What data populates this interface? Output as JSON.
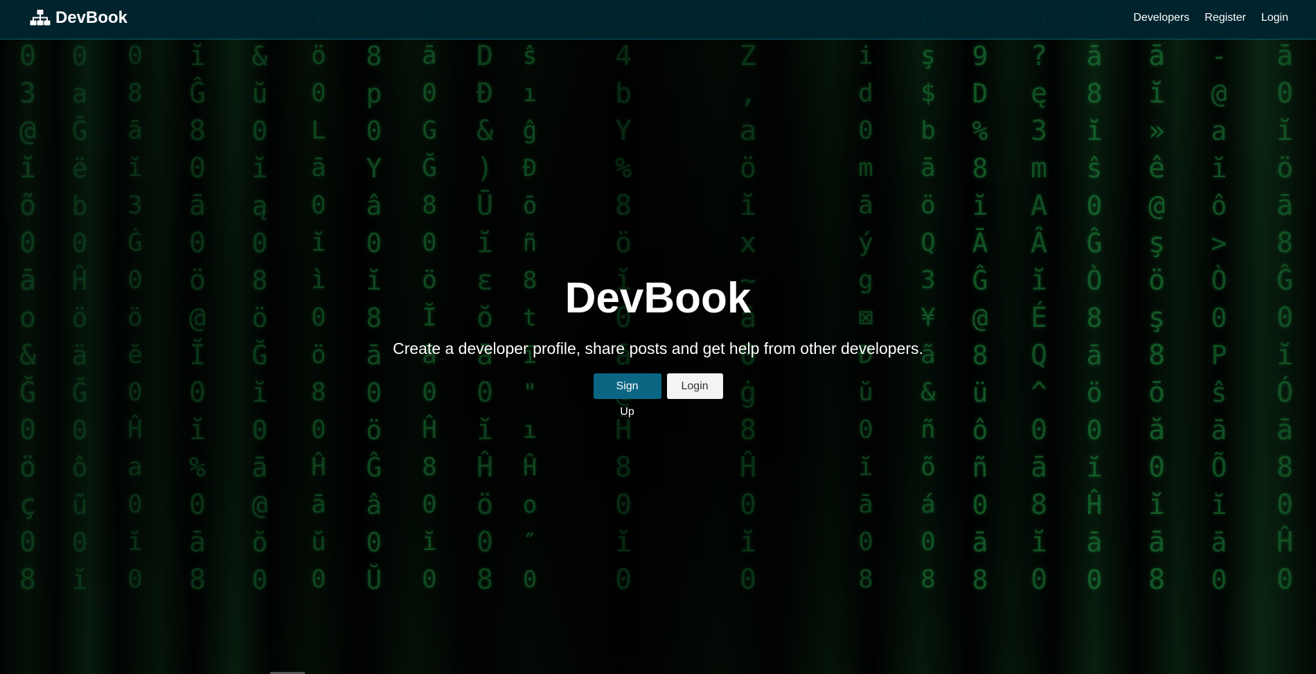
{
  "navbar": {
    "brand_icon": "sitemap-icon",
    "brand": "DevBook",
    "links": [
      "Developers",
      "Register",
      "Login"
    ]
  },
  "hero": {
    "title": "DevBook",
    "lead": "Create a developer profile, share posts and get help from other developers.",
    "signup_label": "Sign Up",
    "login_label": "Login"
  },
  "colors": {
    "navbar_bg": "#002430",
    "primary": "#0b6684",
    "light": "#f4f4f4",
    "matrix_green": "#1d8a3c"
  }
}
